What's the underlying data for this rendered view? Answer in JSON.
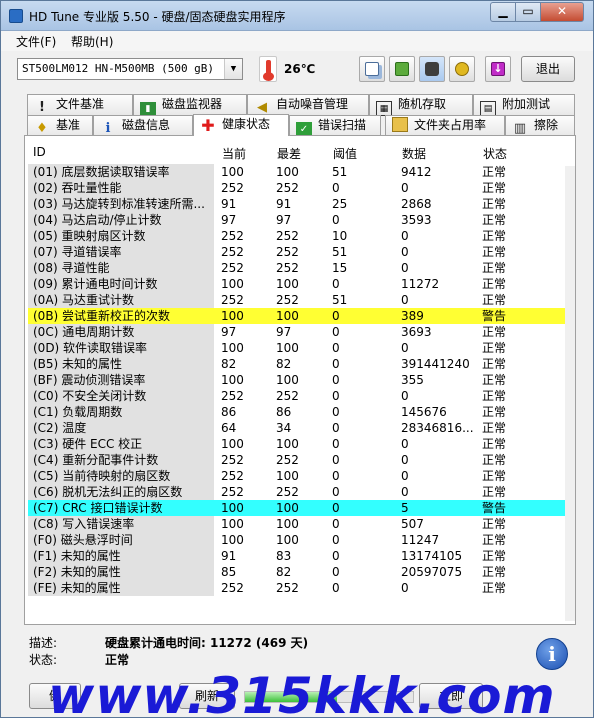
{
  "window": {
    "title": "HD Tune 专业版 5.50 - 硬盘/固态硬盘实用程序"
  },
  "titlebar": {
    "minimize": "▁",
    "maximize": "▭",
    "close": "✕"
  },
  "menu": {
    "file": "文件(F)",
    "help": "帮助(H)"
  },
  "toolbar": {
    "drive": "ST500LM012 HN-M500MB (500 gB)",
    "temperature": "26℃",
    "exit": "退出",
    "icons": [
      "copy-info-icon",
      "copy-screen-icon",
      "camera-icon",
      "options-icon",
      "save-icon"
    ]
  },
  "tabs_top": [
    {
      "label": "文件基准",
      "icon": "file-benchmark-icon"
    },
    {
      "label": "磁盘监视器",
      "icon": "disk-monitor-icon"
    },
    {
      "label": "自动噪音管理",
      "icon": "speaker-icon"
    },
    {
      "label": "随机存取",
      "icon": "random-access-icon"
    },
    {
      "label": "附加测试",
      "icon": "extra-tests-icon"
    }
  ],
  "tabs_bottom": [
    {
      "label": "基准",
      "icon": "benchmark-icon"
    },
    {
      "label": "磁盘信息",
      "icon": "info-icon"
    },
    {
      "label": "健康状态",
      "icon": "health-cross-icon"
    },
    {
      "label": "错误扫描",
      "icon": "error-scan-icon"
    },
    {
      "label": "文件夹占用率",
      "icon": "folder-icon"
    },
    {
      "label": "擦除",
      "icon": "trash-icon"
    }
  ],
  "table": {
    "columns": [
      "ID",
      "当前",
      "最差",
      "阈值",
      "数据",
      "状态"
    ],
    "rows": [
      [
        "(01) 底层数据读取错误率",
        "100",
        "100",
        "51",
        "9412",
        "正常"
      ],
      [
        "(02) 吞吐量性能",
        "252",
        "252",
        "0",
        "0",
        "正常"
      ],
      [
        "(03) 马达旋转到标准转速所需...",
        "91",
        "91",
        "25",
        "2868",
        "正常"
      ],
      [
        "(04) 马达启动/停止计数",
        "97",
        "97",
        "0",
        "3593",
        "正常"
      ],
      [
        "(05) 重映射扇区计数",
        "252",
        "252",
        "10",
        "0",
        "正常"
      ],
      [
        "(07) 寻道错误率",
        "252",
        "252",
        "51",
        "0",
        "正常"
      ],
      [
        "(08) 寻道性能",
        "252",
        "252",
        "15",
        "0",
        "正常"
      ],
      [
        "(09) 累计通电时间计数",
        "100",
        "100",
        "0",
        "11272",
        "正常"
      ],
      [
        "(0A) 马达重试计数",
        "252",
        "252",
        "51",
        "0",
        "正常"
      ],
      [
        "(0B) 尝试重新校正的次数",
        "100",
        "100",
        "0",
        "389",
        "警告"
      ],
      [
        "(0C) 通电周期计数",
        "97",
        "97",
        "0",
        "3693",
        "正常"
      ],
      [
        "(0D) 软件读取错误率",
        "100",
        "100",
        "0",
        "0",
        "正常"
      ],
      [
        "(B5) 未知的属性",
        "82",
        "82",
        "0",
        "391441240",
        "正常"
      ],
      [
        "(BF) 震动侦测错误率",
        "100",
        "100",
        "0",
        "355",
        "正常"
      ],
      [
        "(C0) 不安全关闭计数",
        "252",
        "252",
        "0",
        "0",
        "正常"
      ],
      [
        "(C1) 负载周期数",
        "86",
        "86",
        "0",
        "145676",
        "正常"
      ],
      [
        "(C2) 温度",
        "64",
        "34",
        "0",
        "28346816...",
        "正常"
      ],
      [
        "(C3) 硬件 ECC 校正",
        "100",
        "100",
        "0",
        "0",
        "正常"
      ],
      [
        "(C4) 重新分配事件计数",
        "252",
        "252",
        "0",
        "0",
        "正常"
      ],
      [
        "(C5) 当前待映射的扇区数",
        "252",
        "100",
        "0",
        "0",
        "正常"
      ],
      [
        "(C6) 脱机无法纠正的扇区数",
        "252",
        "252",
        "0",
        "0",
        "正常"
      ],
      [
        "(C7) CRC 接口错误计数",
        "100",
        "100",
        "0",
        "5",
        "警告"
      ],
      [
        "(C8) 写入错误速率",
        "100",
        "100",
        "0",
        "507",
        "正常"
      ],
      [
        "(F0) 磁头悬浮时间",
        "100",
        "100",
        "0",
        "11247",
        "正常"
      ],
      [
        "(F1) 未知的属性",
        "91",
        "83",
        "0",
        "13174105",
        "正常"
      ],
      [
        "(F2) 未知的属性",
        "85",
        "82",
        "0",
        "20597075",
        "正常"
      ],
      [
        "(FE) 未知的属性",
        "252",
        "252",
        "0",
        "0",
        "正常"
      ]
    ],
    "highlights": {
      "yellow_row": 9,
      "cyan_row": 21,
      "yellow": "#ffff33",
      "cyan": "#33ffff"
    }
  },
  "details": {
    "desc_label": "描述:",
    "desc_value": "硬盘累计通电时间: 11272 (469 天)",
    "status_label": "状态:",
    "status_value": "正常"
  },
  "bottom": {
    "left_btn": "健",
    "refresh": "刷新",
    "right_btn": "立即",
    "progress": 0.55
  },
  "watermark": "www.315kkk.com"
}
